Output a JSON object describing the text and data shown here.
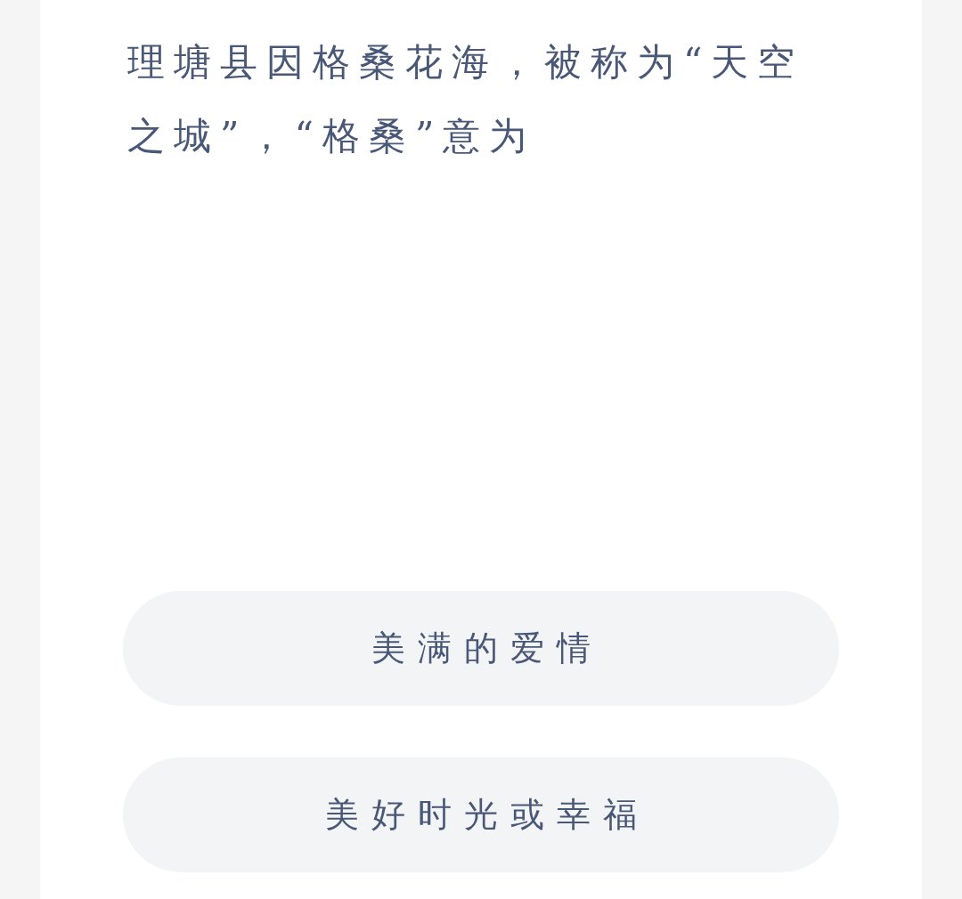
{
  "question": "理塘县因格桑花海，被称为“天空之城”，“格桑”意为",
  "options": [
    {
      "label": "美满的爱情"
    },
    {
      "label": "美好时光或幸福"
    }
  ]
}
